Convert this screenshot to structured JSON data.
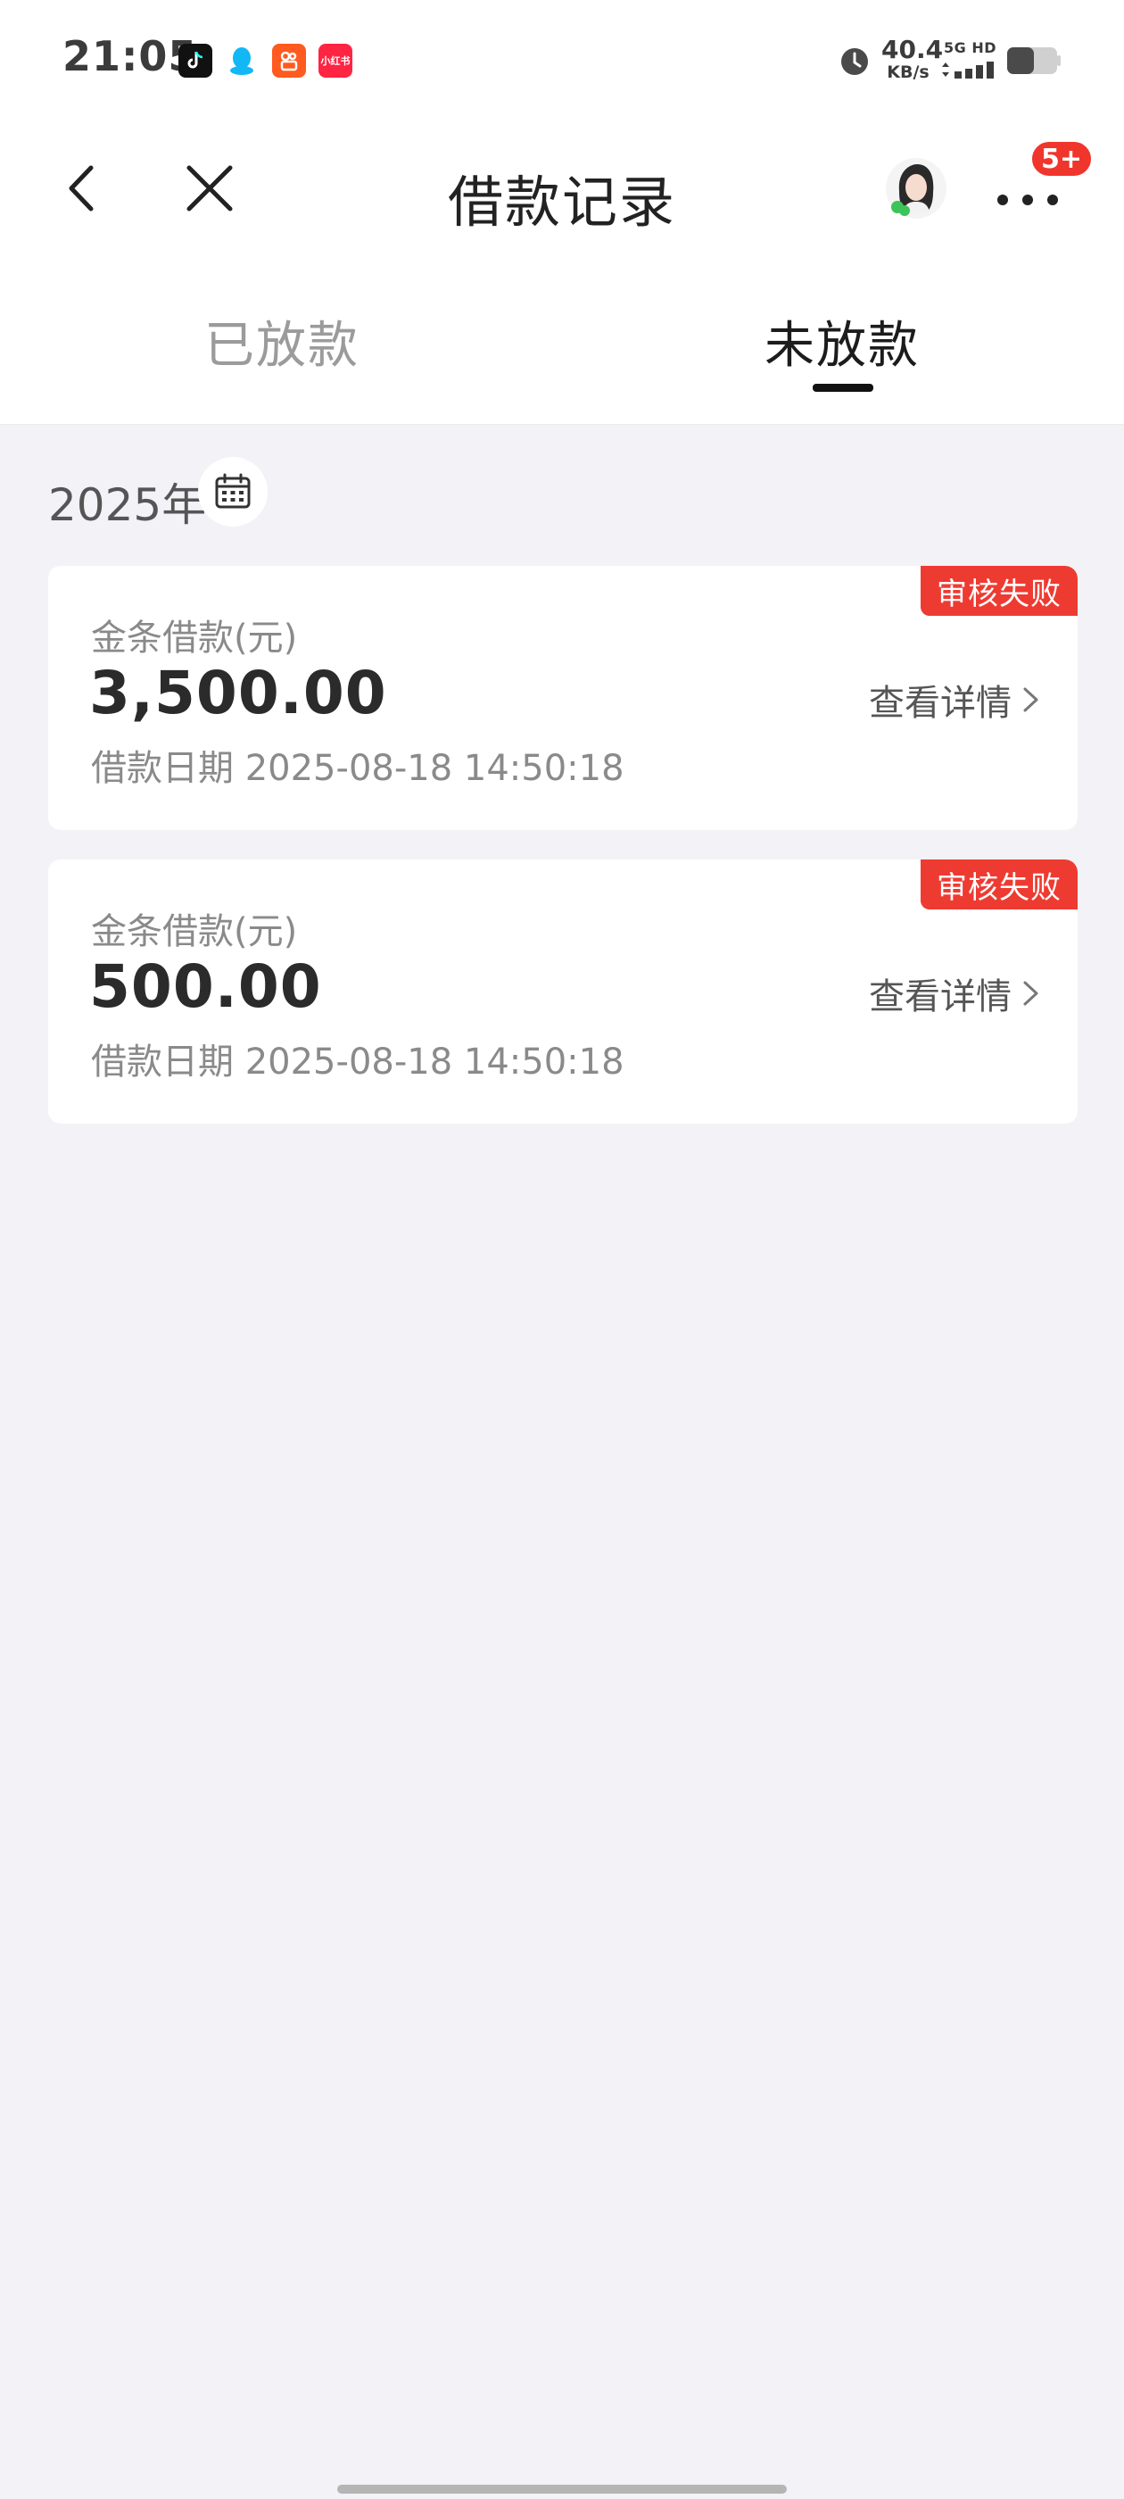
{
  "status_bar": {
    "time": "21:05",
    "app_icons": [
      "tiktok-icon",
      "qq-icon",
      "kuaishou-icon",
      "xiaohongshu-icon"
    ],
    "xhs_label": "小红书",
    "net_speed_value": "40.4",
    "net_speed_unit": "KB/s",
    "network_label": "5G HD",
    "battery_icon": "battery-icon"
  },
  "header": {
    "title": "借款记录",
    "notification_badge": "5+"
  },
  "tabs": [
    {
      "label": "已放款",
      "active": false
    },
    {
      "label": "未放款",
      "active": true
    }
  ],
  "year": "2025年",
  "records": [
    {
      "product": "金条借款(元)",
      "amount": "3,500.00",
      "date": "借款日期 2025-08-18 14:50:18",
      "status": "审核失败",
      "detail_label": "查看详情"
    },
    {
      "product": "金条借款(元)",
      "amount": "500.00",
      "date": "借款日期 2025-08-18 14:50:18",
      "status": "审核失败",
      "detail_label": "查看详情"
    }
  ],
  "colors": {
    "accent_red": "#ee3b32",
    "page_background": "#f2f2f7",
    "tab_active": "#1c1c1c",
    "tab_inactive": "#9b9b9b"
  }
}
